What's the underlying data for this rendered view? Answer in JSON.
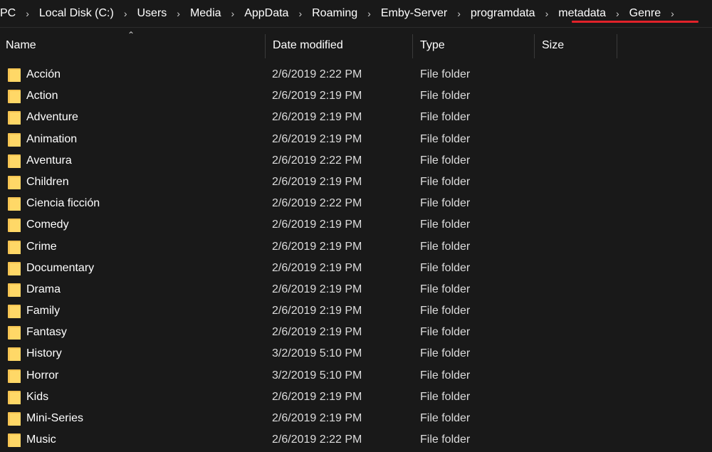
{
  "breadcrumb": [
    "PC",
    "Local Disk (C:)",
    "Users",
    "Media",
    "AppData",
    "Roaming",
    "Emby-Server",
    "programdata",
    "metadata",
    "Genre"
  ],
  "columns": {
    "name": "Name",
    "date": "Date modified",
    "type": "Type",
    "size": "Size"
  },
  "highlight_color": "#e2222a",
  "files": [
    {
      "name": "Acción",
      "date": "2/6/2019 2:22 PM",
      "type": "File folder"
    },
    {
      "name": "Action",
      "date": "2/6/2019 2:19 PM",
      "type": "File folder"
    },
    {
      "name": "Adventure",
      "date": "2/6/2019 2:19 PM",
      "type": "File folder"
    },
    {
      "name": "Animation",
      "date": "2/6/2019 2:19 PM",
      "type": "File folder"
    },
    {
      "name": "Aventura",
      "date": "2/6/2019 2:22 PM",
      "type": "File folder"
    },
    {
      "name": "Children",
      "date": "2/6/2019 2:19 PM",
      "type": "File folder"
    },
    {
      "name": "Ciencia ficción",
      "date": "2/6/2019 2:22 PM",
      "type": "File folder"
    },
    {
      "name": "Comedy",
      "date": "2/6/2019 2:19 PM",
      "type": "File folder"
    },
    {
      "name": "Crime",
      "date": "2/6/2019 2:19 PM",
      "type": "File folder"
    },
    {
      "name": "Documentary",
      "date": "2/6/2019 2:19 PM",
      "type": "File folder"
    },
    {
      "name": "Drama",
      "date": "2/6/2019 2:19 PM",
      "type": "File folder"
    },
    {
      "name": "Family",
      "date": "2/6/2019 2:19 PM",
      "type": "File folder"
    },
    {
      "name": "Fantasy",
      "date": "2/6/2019 2:19 PM",
      "type": "File folder"
    },
    {
      "name": "History",
      "date": "3/2/2019 5:10 PM",
      "type": "File folder"
    },
    {
      "name": "Horror",
      "date": "3/2/2019 5:10 PM",
      "type": "File folder"
    },
    {
      "name": "Kids",
      "date": "2/6/2019 2:19 PM",
      "type": "File folder"
    },
    {
      "name": "Mini-Series",
      "date": "2/6/2019 2:19 PM",
      "type": "File folder"
    },
    {
      "name": "Music",
      "date": "2/6/2019 2:22 PM",
      "type": "File folder"
    }
  ]
}
